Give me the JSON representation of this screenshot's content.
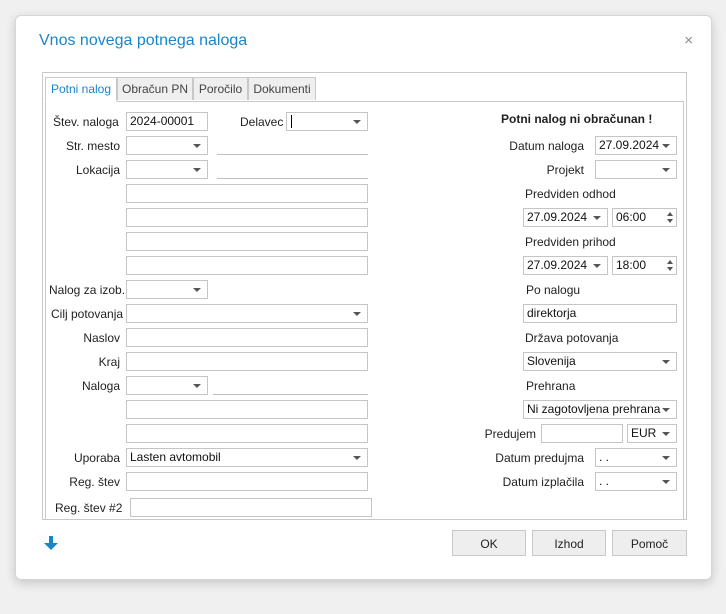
{
  "dialog": {
    "title": "Vnos novega potnega naloga",
    "close_glyph": "×"
  },
  "tabs": [
    {
      "label": "Potni nalog",
      "active": true
    },
    {
      "label": "Obračun PN",
      "active": false
    },
    {
      "label": "Poročilo",
      "active": false
    },
    {
      "label": "Dokumenti",
      "active": false
    }
  ],
  "left": {
    "stev_naloga": {
      "label": "Štev. naloga",
      "value": "2024-00001"
    },
    "delavec": {
      "label": "Delavec",
      "value": ""
    },
    "str_mesto": {
      "label": "Str. mesto",
      "value": ""
    },
    "lokacija": {
      "label": "Lokacija",
      "value": ""
    },
    "nalog_za_izob": {
      "label": "Nalog za izob.",
      "value": ""
    },
    "cilj_potovanja": {
      "label": "Cilj potovanja",
      "value": ""
    },
    "naslov": {
      "label": "Naslov",
      "value": ""
    },
    "kraj": {
      "label": "Kraj",
      "value": ""
    },
    "naloga": {
      "label": "Naloga",
      "value": ""
    },
    "uporaba": {
      "label": "Uporaba",
      "value": "Lasten avtomobil"
    },
    "reg_stev": {
      "label": "Reg. štev",
      "value": ""
    },
    "reg_stev2": {
      "label": "Reg. štev #2",
      "value": ""
    }
  },
  "right": {
    "status": "Potni nalog ni obračunan !",
    "datum_naloga": {
      "label": "Datum naloga",
      "value": "27.09.2024"
    },
    "projekt": {
      "label": "Projekt",
      "value": ""
    },
    "predviden_odhod": {
      "label": "Predviden odhod",
      "date": "27.09.2024",
      "time": "06:00"
    },
    "predviden_prihod": {
      "label": "Predviden prihod",
      "date": "27.09.2024",
      "time": "18:00"
    },
    "po_nalogu": {
      "label": "Po nalogu",
      "value": "direktorja"
    },
    "drzava": {
      "label": "Država potovanja",
      "value": "Slovenija"
    },
    "prehrana": {
      "label": "Prehrana",
      "value": "Ni zagotovljena prehrana"
    },
    "predujem": {
      "label": "Predujem",
      "value": "",
      "currency": "EUR"
    },
    "datum_predujma": {
      "label": "Datum predujma",
      "value": ". ."
    },
    "datum_izplacila": {
      "label": "Datum izplačila",
      "value": ". ."
    }
  },
  "buttons": {
    "ok": "OK",
    "izhod": "Izhod",
    "pomoc": "Pomoč"
  },
  "icons": {
    "accent": "#1a86c8",
    "down_arrow": "arrow-down-icon"
  }
}
